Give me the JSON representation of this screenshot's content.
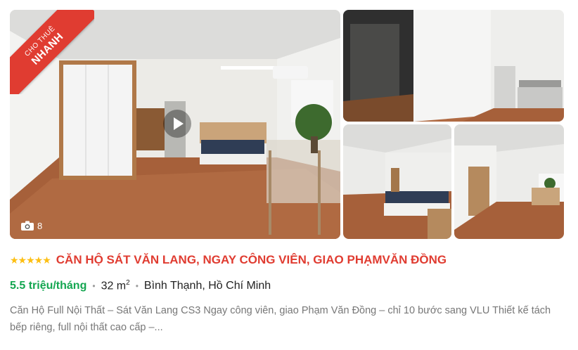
{
  "listing": {
    "badge": {
      "top": "CHO THUÊ",
      "main": "NHANH"
    },
    "photo_count": "8",
    "stars": "★★★★★",
    "title": "CĂN HỘ SÁT VĂN LANG, NGAY CÔNG VIÊN, GIAO PHẠMVĂN ĐỒNG",
    "price": "5.5 triệu/tháng",
    "area_value": "32 m",
    "area_sup": "2",
    "location": "Bình Thạnh, Hồ Chí Minh",
    "separator": "•",
    "description": "Căn Hộ Full Nội Thất – Sát Văn Lang CS3 Ngay công viên, giao Phạm Văn Đồng – chỉ 10 bước sang VLU Thiết kế tách bếp riêng, full nội thất cao cấp –..."
  },
  "colors": {
    "accent_red": "#e03c31",
    "price_green": "#13a650",
    "star_yellow": "#fdbf13",
    "description_gray": "#777777"
  },
  "icons": {
    "camera": "camera-icon",
    "play": "play-icon"
  }
}
